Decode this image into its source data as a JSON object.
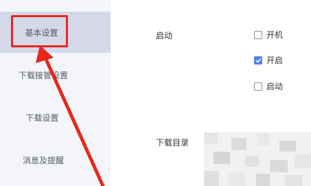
{
  "sidebar": {
    "items": [
      {
        "label": "基本设置"
      },
      {
        "label": "下载接管设置"
      },
      {
        "label": "下载设置"
      },
      {
        "label": "消息及提醒"
      }
    ]
  },
  "main": {
    "startup_label": "启动",
    "options": [
      {
        "label": "开机",
        "checked": false
      },
      {
        "label": "开启",
        "checked": true
      },
      {
        "label": "启动",
        "checked": false
      }
    ],
    "download_dir_label": "下载目录"
  },
  "colors": {
    "accent": "#4f7ff0",
    "annotation": "#e8271e",
    "sidebar_bg": "#f4f5f9",
    "sidebar_active": "#d4d8e8"
  }
}
